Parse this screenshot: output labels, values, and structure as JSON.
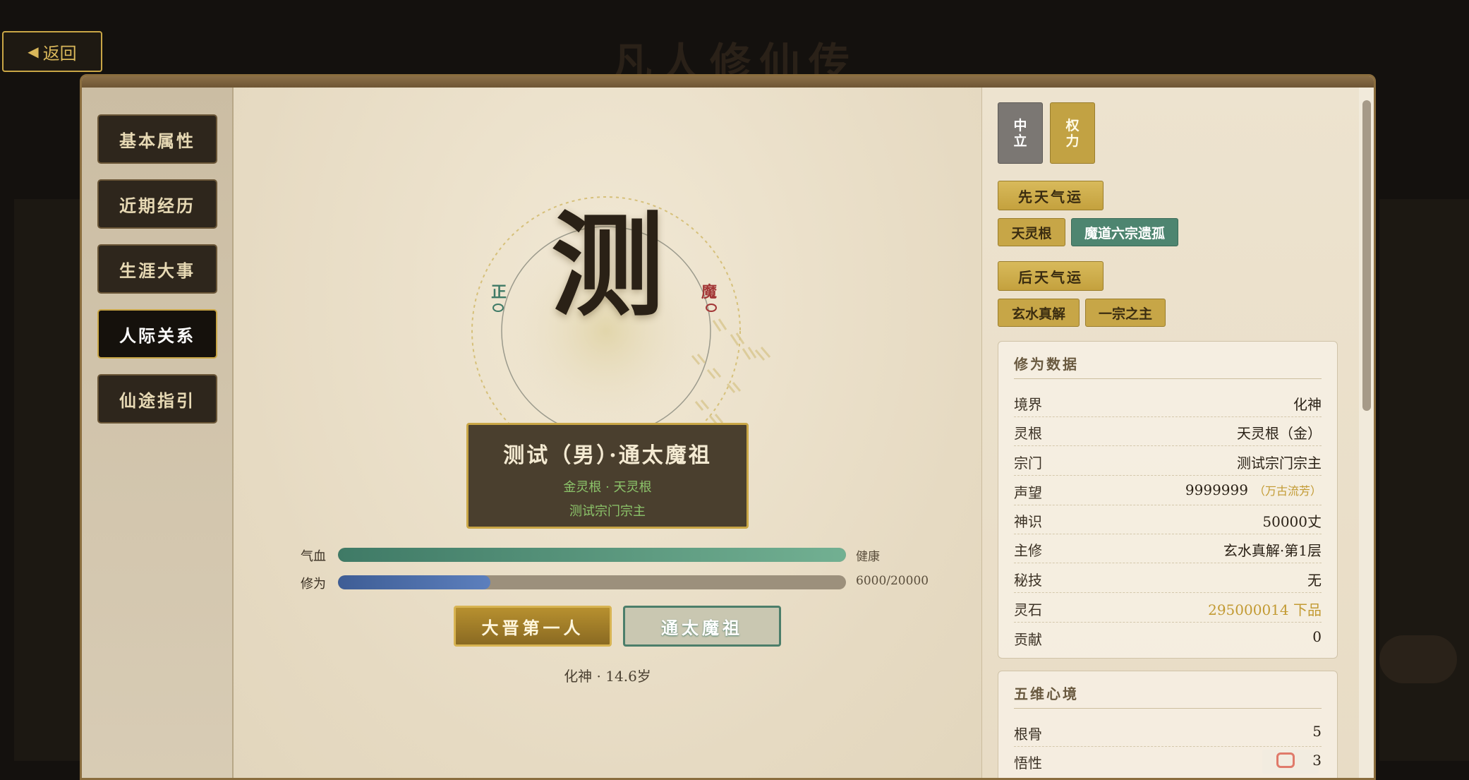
{
  "background_title": "凡人修仙传",
  "back_button": {
    "label": "返回",
    "icon": "triangle-left-icon"
  },
  "nav": {
    "items": [
      {
        "label": "基本属性",
        "active": false
      },
      {
        "label": "近期经历",
        "active": false
      },
      {
        "label": "生涯大事",
        "active": false
      },
      {
        "label": "人际关系",
        "active": true
      },
      {
        "label": "仙途指引",
        "active": false
      }
    ]
  },
  "portrait": {
    "character": "测",
    "left_marker": "正",
    "right_marker": "魔"
  },
  "namecard": {
    "name": "测试（男）·通太魔祖",
    "line1": "金灵根 · 天灵根",
    "line2": "测试宗门宗主"
  },
  "bars": {
    "hp": {
      "label": "气血",
      "status": "健康",
      "fill": 1.0
    },
    "cultivation": {
      "label": "修为",
      "value_text": "6000/20000",
      "current": 6000,
      "max": 20000
    }
  },
  "titles": {
    "primary": "大晋第一人",
    "secondary": "通太魔祖"
  },
  "level_age": "化神 · 14.6岁",
  "alignment_tags": [
    {
      "text": "中立",
      "style": "neutral"
    },
    {
      "text": "权力",
      "style": "gold"
    }
  ],
  "innate_fortune": {
    "heading": "先天气运",
    "tags": [
      "天灵根",
      "魔道六宗遗孤"
    ]
  },
  "acquired_fortune": {
    "heading": "后天气运",
    "tags": [
      "玄水真解",
      "一宗之主"
    ]
  },
  "cultivation_data": {
    "title": "修为数据",
    "rows": [
      {
        "key": "境界",
        "value": "化神"
      },
      {
        "key": "灵根",
        "value": "天灵根（金）"
      },
      {
        "key": "宗门",
        "value": "测试宗门宗主"
      },
      {
        "key": "声望",
        "value": "9999999",
        "note": "（万古流芳）"
      },
      {
        "key": "神识",
        "value": "50000丈"
      },
      {
        "key": "主修",
        "value": "玄水真解·第1层"
      },
      {
        "key": "秘技",
        "value": "无"
      },
      {
        "key": "灵石",
        "value": "295000014 下品"
      },
      {
        "key": "贡献",
        "value": "0"
      }
    ]
  },
  "mind_state": {
    "title": "五维心境",
    "rows": [
      {
        "key": "根骨",
        "value": "5"
      },
      {
        "key": "悟性",
        "value": "3"
      }
    ]
  },
  "colors": {
    "gold_accent": "#c9a646",
    "righteous_green": "#3f7a66",
    "demonic_red": "#a23636"
  }
}
